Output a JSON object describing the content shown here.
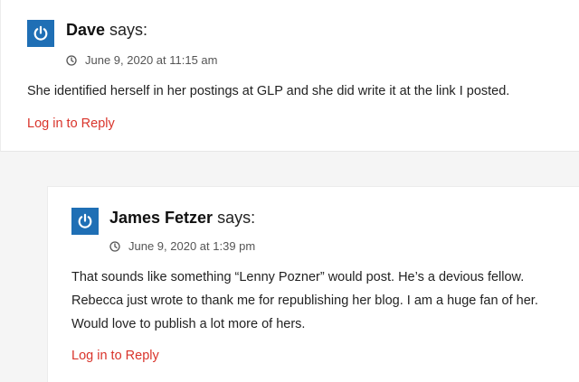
{
  "comments": [
    {
      "author": "Dave",
      "says": "says:",
      "date": "June 9, 2020 at 11:15 am",
      "text": "She identified herself in her postings at GLP and she did write it at the link I posted.",
      "reply_label": "Log in to Reply",
      "avatar_icon": "power-icon",
      "date_icon": "clock-icon"
    },
    {
      "author": "James Fetzer",
      "says": "says:",
      "date": "June 9, 2020 at 1:39 pm",
      "text": "That sounds like something “Lenny Pozner” would post. He’s a devious fellow. Rebecca just wrote to thank me for republishing her blog. I am a huge fan of her. Would love to publish a lot more of hers.",
      "reply_label": "Log in to Reply",
      "avatar_icon": "power-icon",
      "date_icon": "clock-icon"
    }
  ],
  "colors": {
    "avatar_bg": "#1f6fb5",
    "link": "#d9342b",
    "page_bg": "#f5f5f5"
  }
}
